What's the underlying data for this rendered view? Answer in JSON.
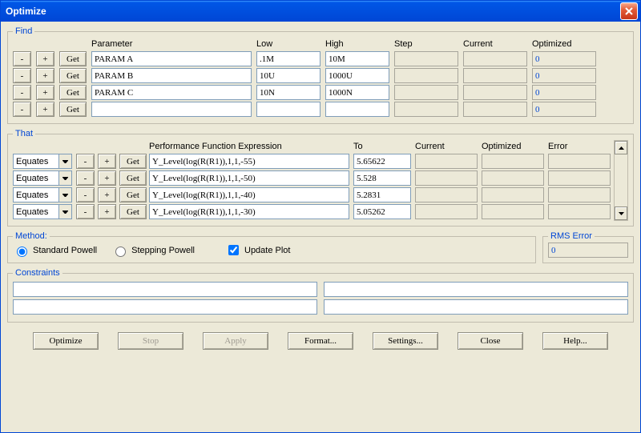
{
  "window": {
    "title": "Optimize"
  },
  "find": {
    "headers": {
      "param": "Parameter",
      "low": "Low",
      "high": "High",
      "step": "Step",
      "current": "Current",
      "optimized": "Optimized"
    },
    "btn_minus": "-",
    "btn_plus": "+",
    "btn_get": "Get",
    "rows": [
      {
        "param": "PARAM A",
        "low": ".1M",
        "high": "10M",
        "step": "",
        "current": "",
        "optimized": "0"
      },
      {
        "param": "PARAM B",
        "low": "10U",
        "high": "1000U",
        "step": "",
        "current": "",
        "optimized": "0"
      },
      {
        "param": "PARAM C",
        "low": "10N",
        "high": "1000N",
        "step": "",
        "current": "",
        "optimized": "0"
      },
      {
        "param": "",
        "low": "",
        "high": "",
        "step": "",
        "current": "",
        "optimized": "0"
      }
    ]
  },
  "that": {
    "headers": {
      "perf": "Performance Function Expression",
      "to": "To",
      "current": "Current",
      "optimized": "Optimized",
      "error": "Error"
    },
    "combo": "Equates",
    "btn_minus": "-",
    "btn_plus": "+",
    "btn_get": "Get",
    "rows": [
      {
        "expr": "Y_Level(log(R(R1)),1,1,-55)",
        "to": "5.65622",
        "current": "",
        "optimized": "",
        "error": ""
      },
      {
        "expr": "Y_Level(log(R(R1)),1,1,-50)",
        "to": "5.528",
        "current": "",
        "optimized": "",
        "error": ""
      },
      {
        "expr": "Y_Level(log(R(R1)),1,1,-40)",
        "to": "5.2831",
        "current": "",
        "optimized": "",
        "error": ""
      },
      {
        "expr": "Y_Level(log(R(R1)),1,1,-30)",
        "to": "5.05262",
        "current": "",
        "optimized": "",
        "error": ""
      }
    ]
  },
  "legends": {
    "find": "Find",
    "that": "That",
    "method": "Method:",
    "rms": "RMS Error",
    "constraints": "Constraints"
  },
  "method": {
    "standard": "Standard Powell",
    "stepping": "Stepping Powell",
    "update": "Update Plot",
    "rms_value": "0"
  },
  "constraints": {
    "r1c1": "",
    "r1c2": "",
    "r2c1": "",
    "r2c2": ""
  },
  "buttons": {
    "optimize": "Optimize",
    "stop": "Stop",
    "apply": "Apply",
    "format": "Format...",
    "settings": "Settings...",
    "close": "Close",
    "help": "Help..."
  }
}
